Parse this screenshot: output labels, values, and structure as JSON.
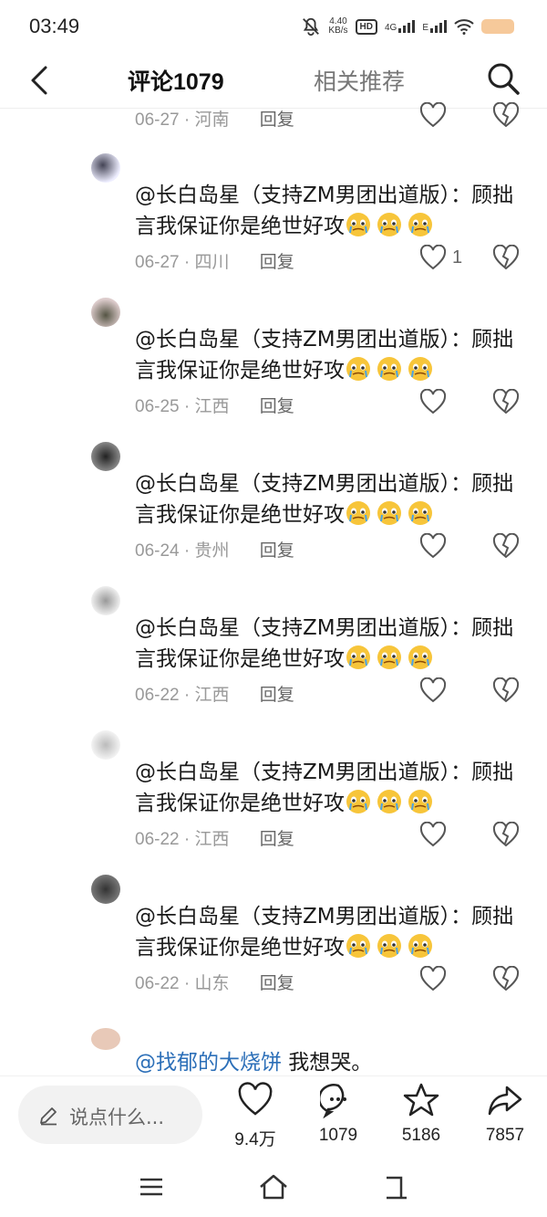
{
  "status_bar": {
    "time": "03:49",
    "speed_value": "4.40",
    "speed_unit": "KB/s",
    "hd": "HD",
    "net1": "4G",
    "net2": "E"
  },
  "header": {
    "tabs": [
      "评论1079",
      "相关推荐"
    ]
  },
  "comments": [
    {
      "text_lead": "",
      "text": "",
      "date": "06-27",
      "location": "河南",
      "reply": "回复",
      "likes": ""
    },
    {
      "text_lead": "@长白岛星（支持ZM男团出道版）：顾拙言我保证你是绝世好攻",
      "date": "06-27",
      "location": "四川",
      "reply": "回复",
      "likes": "1"
    },
    {
      "text_lead": "@长白岛星（支持ZM男团出道版）：顾拙言我保证你是绝世好攻",
      "date": "06-25",
      "location": "江西",
      "reply": "回复",
      "likes": ""
    },
    {
      "text_lead": "@长白岛星（支持ZM男团出道版）：顾拙言我保证你是绝世好攻",
      "date": "06-24",
      "location": "贵州",
      "reply": "回复",
      "likes": ""
    },
    {
      "text_lead": "@长白岛星（支持ZM男团出道版）：顾拙言我保证你是绝世好攻",
      "date": "06-22",
      "location": "江西",
      "reply": "回复",
      "likes": ""
    },
    {
      "text_lead": "@长白岛星（支持ZM男团出道版）：顾拙言我保证你是绝世好攻",
      "date": "06-22",
      "location": "江西",
      "reply": "回复",
      "likes": ""
    },
    {
      "text_lead": "@长白岛星（支持ZM男团出道版）：顾拙言我保证你是绝世好攻",
      "date": "06-22",
      "location": "山东",
      "reply": "回复",
      "likes": ""
    }
  ],
  "partial_comment": {
    "mention": "@找郁的大烧饼",
    "text": " 我想哭。"
  },
  "meta_separator": " · ",
  "emoji_name": "pleading-crying-face-emoji",
  "bottom_bar": {
    "input_placeholder": "说点什么...",
    "likes": "9.4万",
    "comments": "1079",
    "favorites": "5186",
    "shares": "7857"
  },
  "colors": {
    "mention": "#2c6fb8",
    "battery": "#f6c99a",
    "muted": "#999999"
  }
}
